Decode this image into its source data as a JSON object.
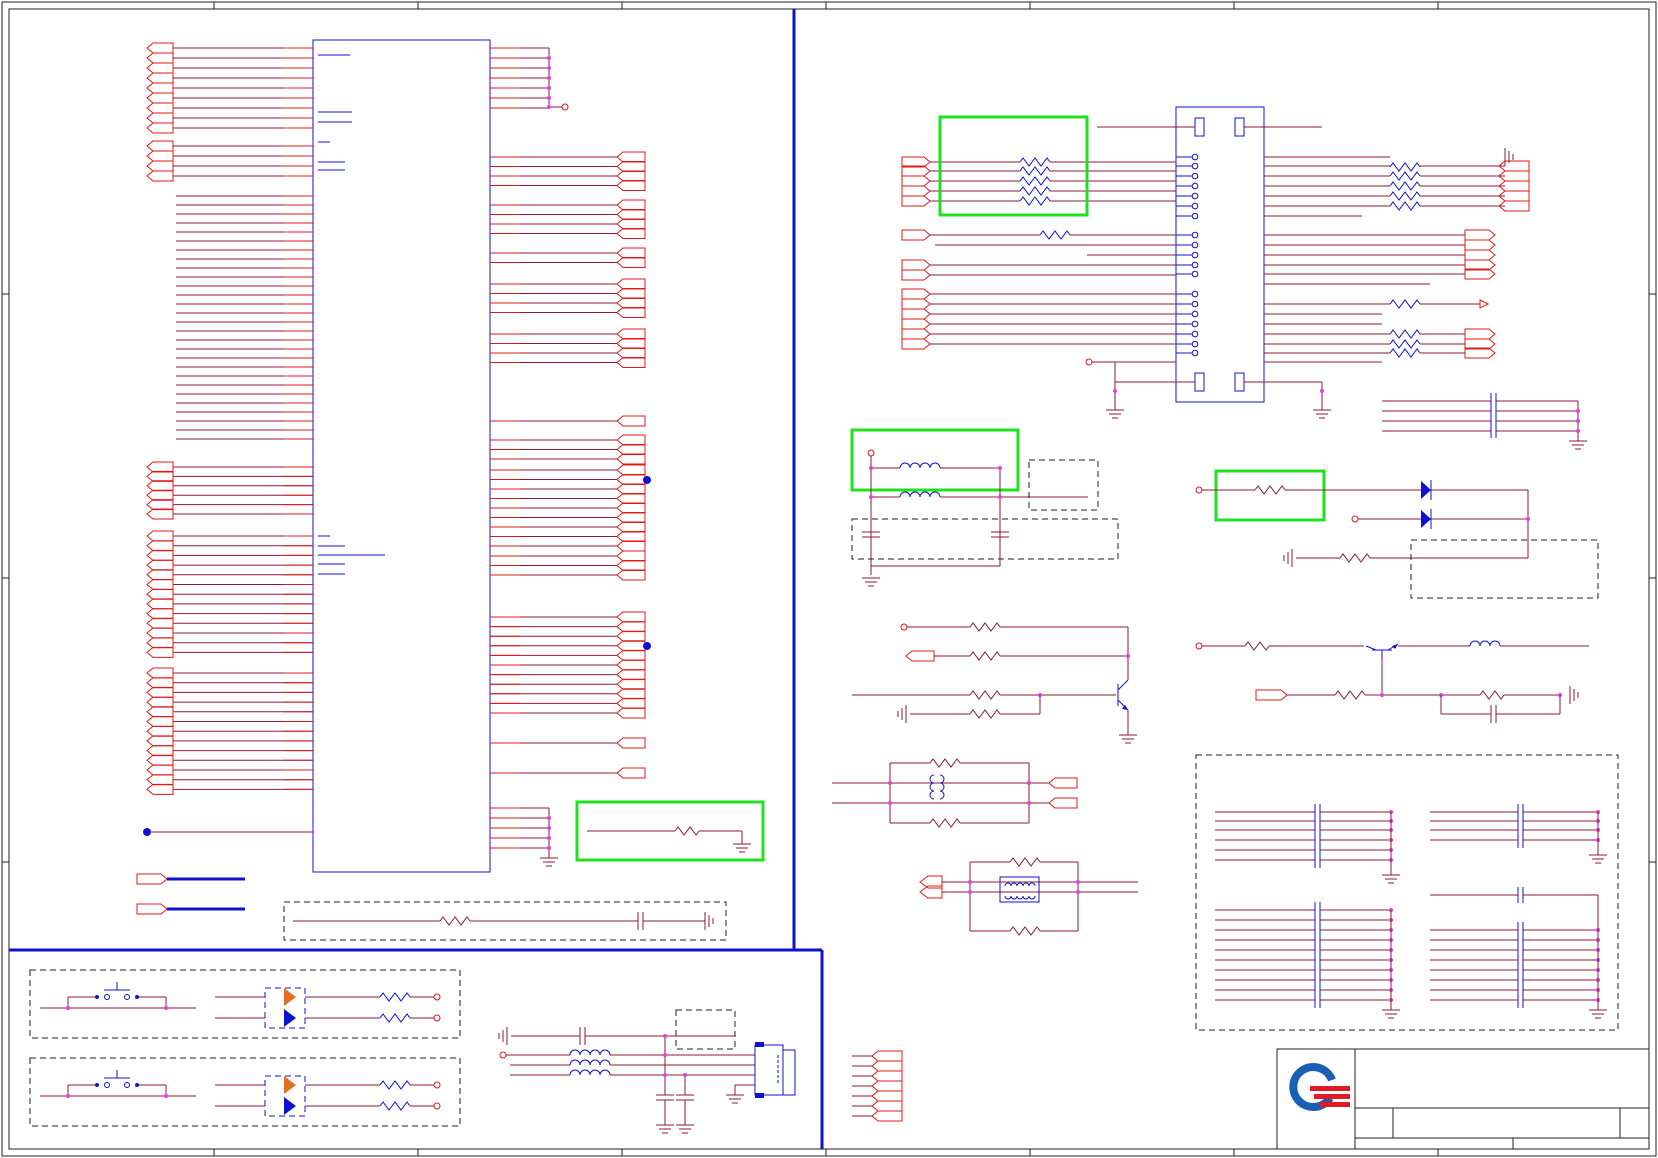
{
  "sheet": {
    "colors": {
      "wire": "#8b1a3a",
      "port": "#e01818",
      "component": "#1010d0",
      "highlight": "#20e020",
      "junction": "#e040e0",
      "logo_blue": "#1a5fb4",
      "logo_red": "#e01b24",
      "led": "#e07020"
    },
    "icons": [
      "company-logo",
      "resistor-icon",
      "inductor-icon",
      "capacitor-icon",
      "diode-icon",
      "transistor-icon",
      "ground-icon",
      "switch-icon",
      "led-icon",
      "connector-icon"
    ]
  }
}
